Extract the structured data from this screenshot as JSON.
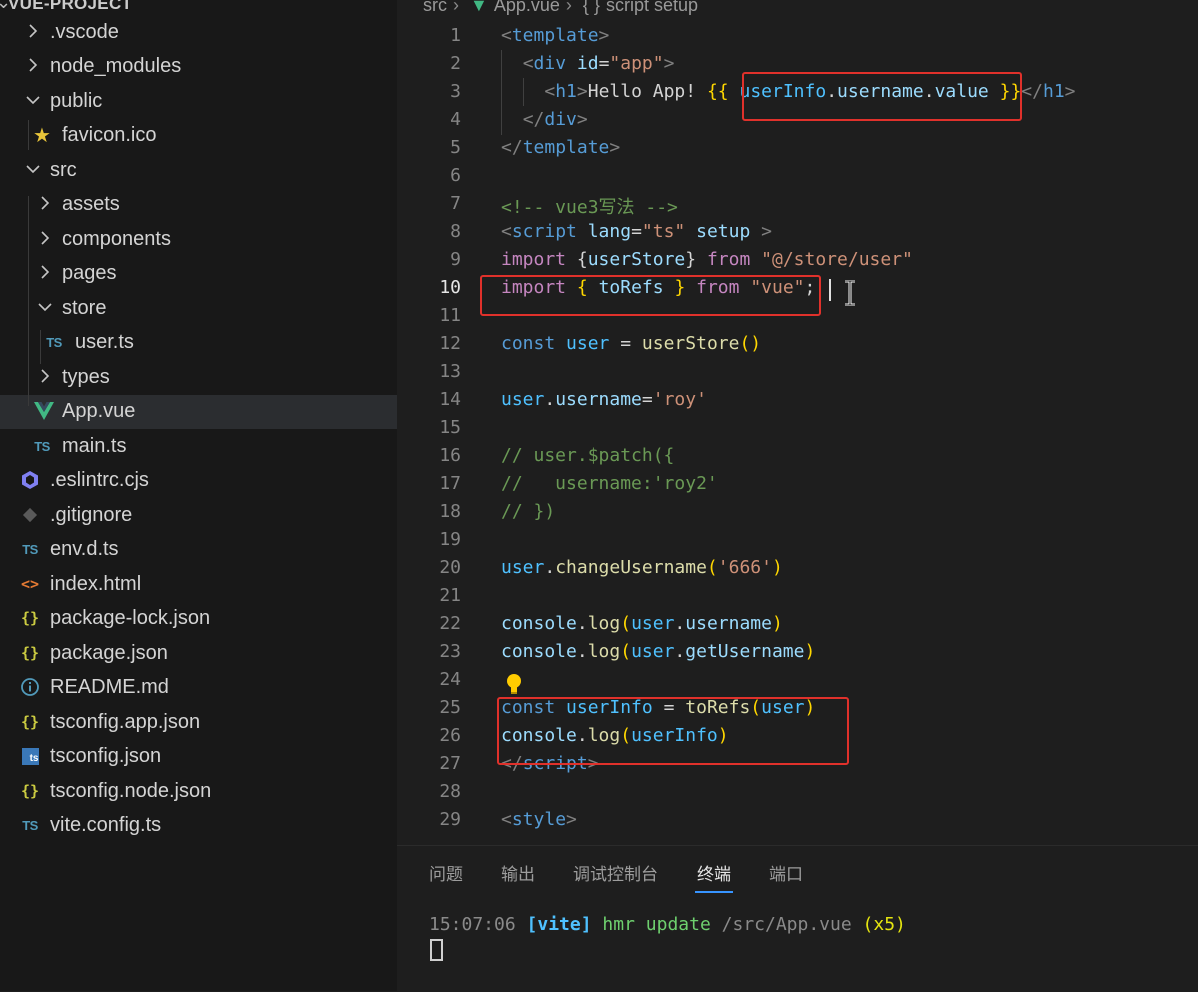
{
  "sidebar": {
    "project": "VUE-PROJECT",
    "items": [
      {
        "label": ".vscode",
        "icon": "chevron-right-icon"
      },
      {
        "label": "node_modules",
        "icon": "chevron-right-icon"
      },
      {
        "label": "public",
        "icon": "chevron-down-icon"
      },
      {
        "label": "favicon.ico",
        "icon": "star-icon"
      },
      {
        "label": "src",
        "icon": "chevron-down-icon"
      },
      {
        "label": "assets",
        "icon": "chevron-right-icon"
      },
      {
        "label": "components",
        "icon": "chevron-right-icon"
      },
      {
        "label": "pages",
        "icon": "chevron-right-icon"
      },
      {
        "label": "store",
        "icon": "chevron-down-icon"
      },
      {
        "label": "user.ts",
        "icon": "ts-file-icon",
        "icon_text": "TS"
      },
      {
        "label": "types",
        "icon": "chevron-right-icon"
      },
      {
        "label": "App.vue",
        "icon": "vue-file-icon",
        "selected": true
      },
      {
        "label": "main.ts",
        "icon": "ts-file-icon",
        "icon_text": "TS"
      },
      {
        "label": ".eslintrc.cjs",
        "icon": "eslint-file-icon"
      },
      {
        "label": ".gitignore",
        "icon": "git-file-icon"
      },
      {
        "label": "env.d.ts",
        "icon": "ts-file-icon",
        "icon_text": "TS"
      },
      {
        "label": "index.html",
        "icon": "html-file-icon",
        "icon_text": "<>"
      },
      {
        "label": "package-lock.json",
        "icon": "json-file-icon",
        "icon_text": "{}"
      },
      {
        "label": "package.json",
        "icon": "json-file-icon",
        "icon_text": "{}"
      },
      {
        "label": "README.md",
        "icon": "info-file-icon"
      },
      {
        "label": "tsconfig.app.json",
        "icon": "json-file-icon",
        "icon_text": "{}"
      },
      {
        "label": "tsconfig.json",
        "icon": "tsconfig-file-icon",
        "icon_text": "ts"
      },
      {
        "label": "tsconfig.node.json",
        "icon": "json-file-icon",
        "icon_text": "{}"
      },
      {
        "label": "vite.config.ts",
        "icon": "ts-file-icon",
        "icon_text": "TS"
      }
    ]
  },
  "breadcrumb": {
    "folder": "src",
    "file": "App.vue",
    "symbol": "script setup",
    "symbol_glyph": "{ }"
  },
  "editor": {
    "active_line": 10,
    "lines": [
      "1",
      "2",
      "3",
      "4",
      "5",
      "6",
      "7",
      "8",
      "9",
      "10",
      "11",
      "12",
      "13",
      "14",
      "15",
      "16",
      "17",
      "18",
      "19",
      "20",
      "21",
      "22",
      "23",
      "24",
      "25",
      "26",
      "27",
      "28",
      "29"
    ]
  },
  "panel": {
    "tabs": [
      "问题",
      "输出",
      "调试控制台",
      "终端",
      "端口"
    ],
    "active_tab": "终端",
    "terminal": {
      "time": "15:07:06",
      "tag": "[vite]",
      "message": "hmr update",
      "path": "/src/App.vue",
      "count": "(x5)"
    }
  },
  "colors": {
    "highlight_box": "#e0312b",
    "selection": "#2b2d30",
    "active_tab_underline": "#3794ff"
  }
}
